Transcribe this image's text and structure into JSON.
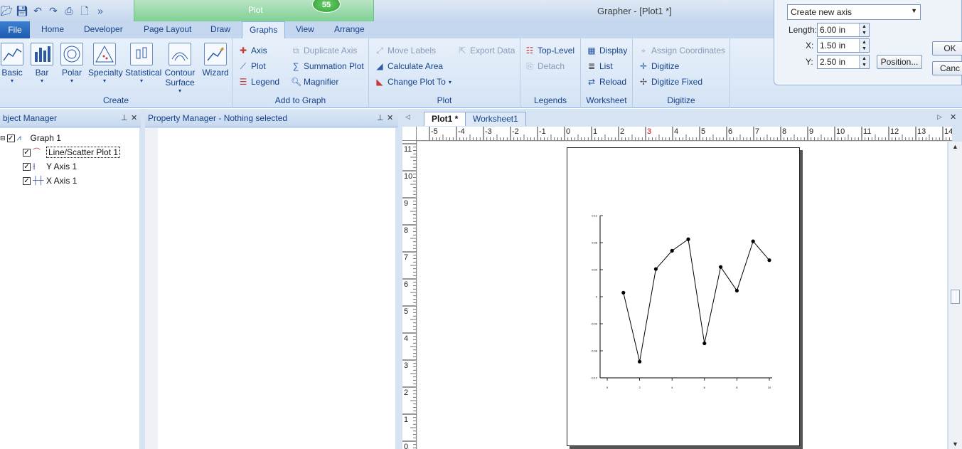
{
  "window": {
    "title": "Grapher - [Plot1 *]",
    "context_tab": "Plot",
    "badge": "55"
  },
  "quick_access": [
    "open-icon",
    "save-icon",
    "undo-icon",
    "redo-icon",
    "print-icon",
    "new-icon",
    "more-icon"
  ],
  "tabs": [
    "File",
    "Home",
    "Developer",
    "Page Layout",
    "Draw",
    "Graphs",
    "View",
    "Arrange"
  ],
  "active_tab": "Graphs",
  "ribbon": {
    "create": {
      "label": "Create",
      "buttons": [
        "Basic",
        "Bar",
        "Polar",
        "Specialty",
        "Statistical",
        "Contour Surface",
        "Wizard"
      ]
    },
    "add_to_graph": {
      "label": "Add to Graph",
      "axis": "Axis",
      "plot": "Plot",
      "legend": "Legend",
      "duplicate_axis": "Duplicate Axis",
      "summation_plot": "Summation Plot",
      "magnifier": "Magnifier"
    },
    "plot": {
      "label": "Plot",
      "move_labels": "Move Labels",
      "export_data": "Export Data",
      "calculate_area": "Calculate Area",
      "change_plot_to": "Change Plot To"
    },
    "legends": {
      "label": "Legends",
      "top_level": "Top-Level",
      "detach": "Detach"
    },
    "worksheet": {
      "label": "Worksheet",
      "display": "Display",
      "list": "List",
      "reload": "Reload"
    },
    "digitize": {
      "label": "Digitize",
      "assign_coordinates": "Assign Coordinates",
      "digitize": "Digitize",
      "digitize_fixed": "Digitize Fixed"
    }
  },
  "axis_dialog": {
    "select_value": "Create new axis",
    "length_label": "Length:",
    "length_value": "6.00 in",
    "x_label": "X:",
    "x_value": "1.50 in",
    "y_label": "Y:",
    "y_value": "2.50 in",
    "position_button": "Position...",
    "ok_button": "OK",
    "cancel_button": "Canc"
  },
  "object_manager": {
    "title": "bject Manager",
    "items": [
      "Graph 1",
      "Line/Scatter Plot 1",
      "Y Axis 1",
      "X Axis 1"
    ]
  },
  "property_manager": {
    "title": "Property Manager - Nothing selected"
  },
  "doc_tabs": [
    "Plot1 *",
    "Worksheet1"
  ],
  "ruler": {
    "h_labels": [
      "-5",
      "-4",
      "-3",
      "-2",
      "-1",
      "0",
      "1",
      "2",
      "3",
      "4",
      "5",
      "6",
      "7",
      "8",
      "9",
      "10",
      "11",
      "12",
      "13",
      "14"
    ],
    "v_labels": [
      "11",
      "10",
      "9",
      "8",
      "7",
      "6",
      "5",
      "4",
      "3",
      "2",
      "1",
      "0"
    ]
  },
  "chart_data": {
    "type": "line",
    "x": [
      1,
      2,
      3,
      4,
      5,
      6,
      7,
      8,
      9,
      10
    ],
    "series": [
      {
        "values": [
          0.006,
          -0.096,
          0.041,
          0.068,
          0.085,
          -0.069,
          0.044,
          0.009,
          0.082,
          0.054
        ]
      }
    ],
    "xlim": [
      0,
      10
    ],
    "ylim": [
      -0.12,
      0.12
    ],
    "xticks": [
      "0",
      "2",
      "4",
      "6",
      "8",
      "10"
    ],
    "yticks": [
      "0.12",
      "0.08",
      "0.04",
      "0",
      "-0.04",
      "-0.08",
      "-0.12"
    ],
    "title": "",
    "xlabel": "",
    "ylabel": "",
    "markers": true,
    "grid": false
  }
}
